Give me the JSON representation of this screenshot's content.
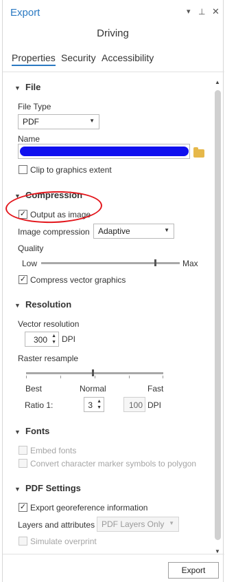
{
  "window": {
    "title": "Export",
    "subtitle": "Driving"
  },
  "tabs": [
    {
      "label": "Properties",
      "active": true
    },
    {
      "label": "Security",
      "active": false
    },
    {
      "label": "Accessibility",
      "active": false
    }
  ],
  "file": {
    "heading": "File",
    "file_type_label": "File Type",
    "file_type_value": "PDF",
    "name_label": "Name",
    "clip_label": "Clip to graphics extent",
    "clip_checked": false
  },
  "compression": {
    "heading": "Compression",
    "output_image_label": "Output as image",
    "output_image_checked": true,
    "image_compression_label": "Image compression",
    "image_compression_value": "Adaptive",
    "quality_label": "Quality",
    "quality_low": "Low",
    "quality_max": "Max",
    "quality_level": 0.82,
    "compress_vector_label": "Compress vector graphics",
    "compress_vector_checked": true
  },
  "resolution": {
    "heading": "Resolution",
    "vector_label": "Vector resolution",
    "vector_value": "300",
    "vector_unit": "DPI",
    "raster_label": "Raster resample",
    "raster_best": "Best",
    "raster_normal": "Normal",
    "raster_fast": "Fast",
    "ratio_label": "Ratio 1:",
    "ratio_value": "3",
    "dpi_value": "100",
    "dpi_unit": "DPI"
  },
  "fonts": {
    "heading": "Fonts",
    "embed_label": "Embed fonts",
    "convert_label": "Convert character marker symbols to polygon"
  },
  "pdf_settings": {
    "heading": "PDF Settings",
    "georef_label": "Export georeference information",
    "georef_checked": true,
    "layers_label": "Layers and attributes",
    "layers_value": "PDF Layers Only",
    "overprint_label": "Simulate overprint"
  },
  "footer": {
    "export_label": "Export"
  },
  "icons": {
    "dropdown": "chevron-down-icon",
    "pin": "pin-icon",
    "close": "close-icon",
    "browse": "folder-icon"
  },
  "colors": {
    "accent": "#2a79c2",
    "annotation": "#e3151b",
    "scribble": "#1010ee"
  }
}
